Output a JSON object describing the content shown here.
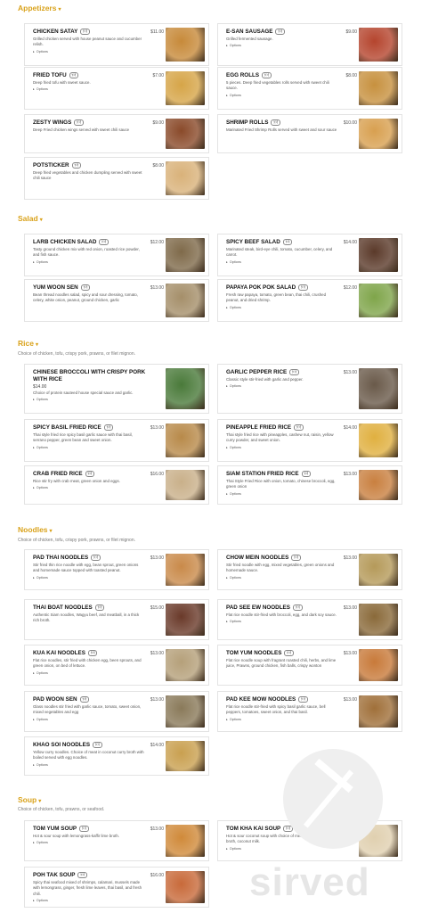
{
  "sections": [
    {
      "title": "Appetizers",
      "caret": "▾",
      "subtitle": "",
      "items": [
        {
          "name": "Chicken Satay",
          "tag": "🍽",
          "price": "$11.00",
          "desc": "Grilled chicken served with house peanut sauce and cucumber relish.",
          "options": "Options",
          "img": "#c78a3a"
        },
        {
          "name": "E-San Sausage",
          "tag": "🍽",
          "price": "$9.00",
          "desc": "Grilled fermented sausage.",
          "options": "Options",
          "img": "#b5452e"
        },
        {
          "name": "Fried Tofu",
          "tag": "🍽",
          "price": "$7.00",
          "desc": "Deep fried tofu with sweet sauce.",
          "options": "Options",
          "img": "#d6a548"
        },
        {
          "name": "Egg Rolls",
          "tag": "🍽",
          "price": "$8.00",
          "desc": "5 pieces. Deep fried vegetables rolls served with sweet chili sauce.",
          "options": "Options",
          "img": "#c7913f"
        },
        {
          "name": "Zesty Wings",
          "tag": "🍽",
          "price": "$9.00",
          "desc": "Deep Fried chicken wings served with sweet chili sauce",
          "options": "",
          "img": "#8a4a2a"
        },
        {
          "name": "Shrimp Rolls",
          "tag": "🍽",
          "price": "$10.00",
          "desc": "Marinated Fried Shrimp Rolls served with sweet and sour sauce",
          "options": "",
          "img": "#d8a050"
        },
        {
          "name": "Potsticker",
          "tag": "🍽",
          "price": "$8.00",
          "desc": "Deep fried vegetables and chicken dumpling served with sweet chili sauce",
          "options": "",
          "img": "#d9b27a"
        }
      ]
    },
    {
      "title": "Salad",
      "caret": "▾",
      "subtitle": "",
      "items": [
        {
          "name": "Larb Chicken Salad",
          "tag": "🍽",
          "price": "$12.00",
          "desc": "Tasty ground chicken mix with red onion, roasted rice powder, and fish sauce.",
          "options": "Options",
          "img": "#7f6a4a"
        },
        {
          "name": "Spicy Beef Salad",
          "tag": "🍽",
          "price": "$14.00",
          "desc": "Marinated steak, bird-eye chili, tomato, cucumber, celery, and carrot.",
          "options": "Options",
          "img": "#5b3a2a"
        },
        {
          "name": "Yum Woon Sen",
          "tag": "🍽",
          "price": "$13.00",
          "desc": "Bean thread noodles salad, spicy and sour dressing, tomato, celery, white onion, peanut, ground chicken, garlic",
          "options": "",
          "img": "#a58f6a"
        },
        {
          "name": "Papaya Pok Pok Salad",
          "tag": "🍽",
          "price": "$12.00",
          "desc": "Fresh raw papaya, tomato, green bean, thai chili, crushed peanut, and dried shrimp.",
          "options": "Options",
          "img": "#7fa54a"
        }
      ]
    },
    {
      "title": "Rice",
      "caret": "▾",
      "subtitle": "Choice of chicken, tofu, crispy pork, prawns, or filet mignon.",
      "items": [
        {
          "name": "Chinese Broccoli with Crispy Pork with Rice",
          "tag": "",
          "price": "$14.00",
          "desc": "Choice of protein sauteed house special sauce and garlic.",
          "options": "Options",
          "img": "#4a7a3a",
          "price_below": true
        },
        {
          "name": "Garlic Pepper Rice",
          "tag": "🍽",
          "price": "$13.00",
          "desc": "Classic style stir-fried with garlic and pepper.",
          "options": "Options",
          "img": "#6a5a4a"
        },
        {
          "name": "Spicy Basil Fried Rice",
          "tag": "🍽",
          "price": "$13.00",
          "desc": "Thai style fried rice spicy basil garlic sauce with thai basil, serrano pepper, green bean and sweet onion.",
          "options": "Options",
          "img": "#b88a4a"
        },
        {
          "name": "Pineapple Fried Rice",
          "tag": "🍽",
          "price": "$14.00",
          "desc": "Thai style fried rice with pineapples, cashew nut, raisin, yellow curry powder, and sweet onion.",
          "options": "Options",
          "img": "#e0b040"
        },
        {
          "name": "Crab Fried Rice",
          "tag": "🍽",
          "price": "$16.00",
          "desc": "Rice stir fry with crab meat, green onion and eggs.",
          "options": "Options",
          "img": "#c9b08a"
        },
        {
          "name": "Siam Station Fried Rice",
          "tag": "🍽",
          "price": "$13.00",
          "desc": "Thai Style Fried Rice with onion, tomato, chinese broccoli, egg, green onion",
          "options": "Options",
          "img": "#c98040"
        }
      ]
    },
    {
      "title": "Noodles",
      "caret": "▾",
      "subtitle": "Choice of chicken, tofu, crispy pork, prawns, or filet mignon.",
      "items": [
        {
          "name": "Pad Thai Noodles",
          "tag": "🍽",
          "price": "$13.00",
          "desc": "Stir fried thin rice noodle with egg, bean sprout, green onions and homemade sauce topped with toasted peanut.",
          "options": "Options",
          "img": "#c98a4a"
        },
        {
          "name": "Chow Mein Noodles",
          "tag": "🍽",
          "price": "$13.00",
          "desc": "Stir fried noodle with egg, mixed vegetables, green onions and homemade sauce.",
          "options": "Options",
          "img": "#b59a5a"
        },
        {
          "name": "Thai Boat Noodles",
          "tag": "🍽",
          "price": "$15.00",
          "desc": "Authentic Siam noodles, Wagyu beef, and meatball, in a thick rich broth.",
          "options": "",
          "img": "#6a3a2a"
        },
        {
          "name": "Pad See Ew Noodles",
          "tag": "🍽",
          "price": "$13.00",
          "desc": "Flat rice noodle stir-fried with broccoli, egg, and dark soy sauce.",
          "options": "Options",
          "img": "#8a6a3a"
        },
        {
          "name": "Kua Kai Noodles",
          "tag": "🍽",
          "price": "$13.00",
          "desc": "Flat rice noodles, stir fried with chicken egg, been sprouts, and green onion, on bed of lettuce.",
          "options": "Options",
          "img": "#b5a07a"
        },
        {
          "name": "Tom Yum Noodles",
          "tag": "🍽",
          "price": "$13.00",
          "desc": "Flat rice noodle soup with fragrant roasted chili, herbs, and lime juice, Prawns, ground chicken, fish balls, crispy wonton",
          "options": "",
          "img": "#c87a3a"
        },
        {
          "name": "Pad Woon Sen",
          "tag": "🍽",
          "price": "$13.00",
          "desc": "Glass noodles stir fried with garlic sauce, tomato, sweet onion, mixed vegetables and egg",
          "options": "Options",
          "img": "#8a7a5a"
        },
        {
          "name": "Pad Kee Mow Noodles",
          "tag": "🍽",
          "price": "$13.00",
          "desc": "Flat rice noodle stir-fried with spicy basil garlic sauce, bell peppers, tomatoes, sweet onion, and thai basil.",
          "options": "Options",
          "img": "#a0703a"
        },
        {
          "name": "Khao Soi Noodles",
          "tag": "🍽",
          "price": "$14.00",
          "desc": "Yellow curry noodles. Choice of meat in coconut curry broth with boiled served with egg noodles.",
          "options": "Options",
          "img": "#c9a050"
        }
      ]
    },
    {
      "title": "Soup",
      "caret": "▾",
      "subtitle": "Choice of chicken, tofu, prawns, or seafood.",
      "items": [
        {
          "name": "Tom Yum Soup",
          "tag": "🍽",
          "price": "$13.00",
          "desc": "Hot & sour soup with lemongrass-kaffir lime broth.",
          "options": "Options",
          "img": "#d08a3a"
        },
        {
          "name": "Tom Kha Kai Soup",
          "tag": "🍽",
          "price": "$13.00",
          "desc": "Hot & sour coconut soup with choice of meat galanga-kaffir lime broth, coconut milk.",
          "options": "Options",
          "img": "#e0d0b0"
        },
        {
          "name": "Poh Tak Soup",
          "tag": "🍽",
          "price": "$16.00",
          "desc": "Spicy thai seafood mixed of shrimps, calamari, mussels made with lemongrass, ginger, fresh lime leaves, thai basil, and fresh chili.",
          "options": "Options",
          "img": "#c86a3a"
        }
      ]
    }
  ],
  "watermark": "sirved"
}
